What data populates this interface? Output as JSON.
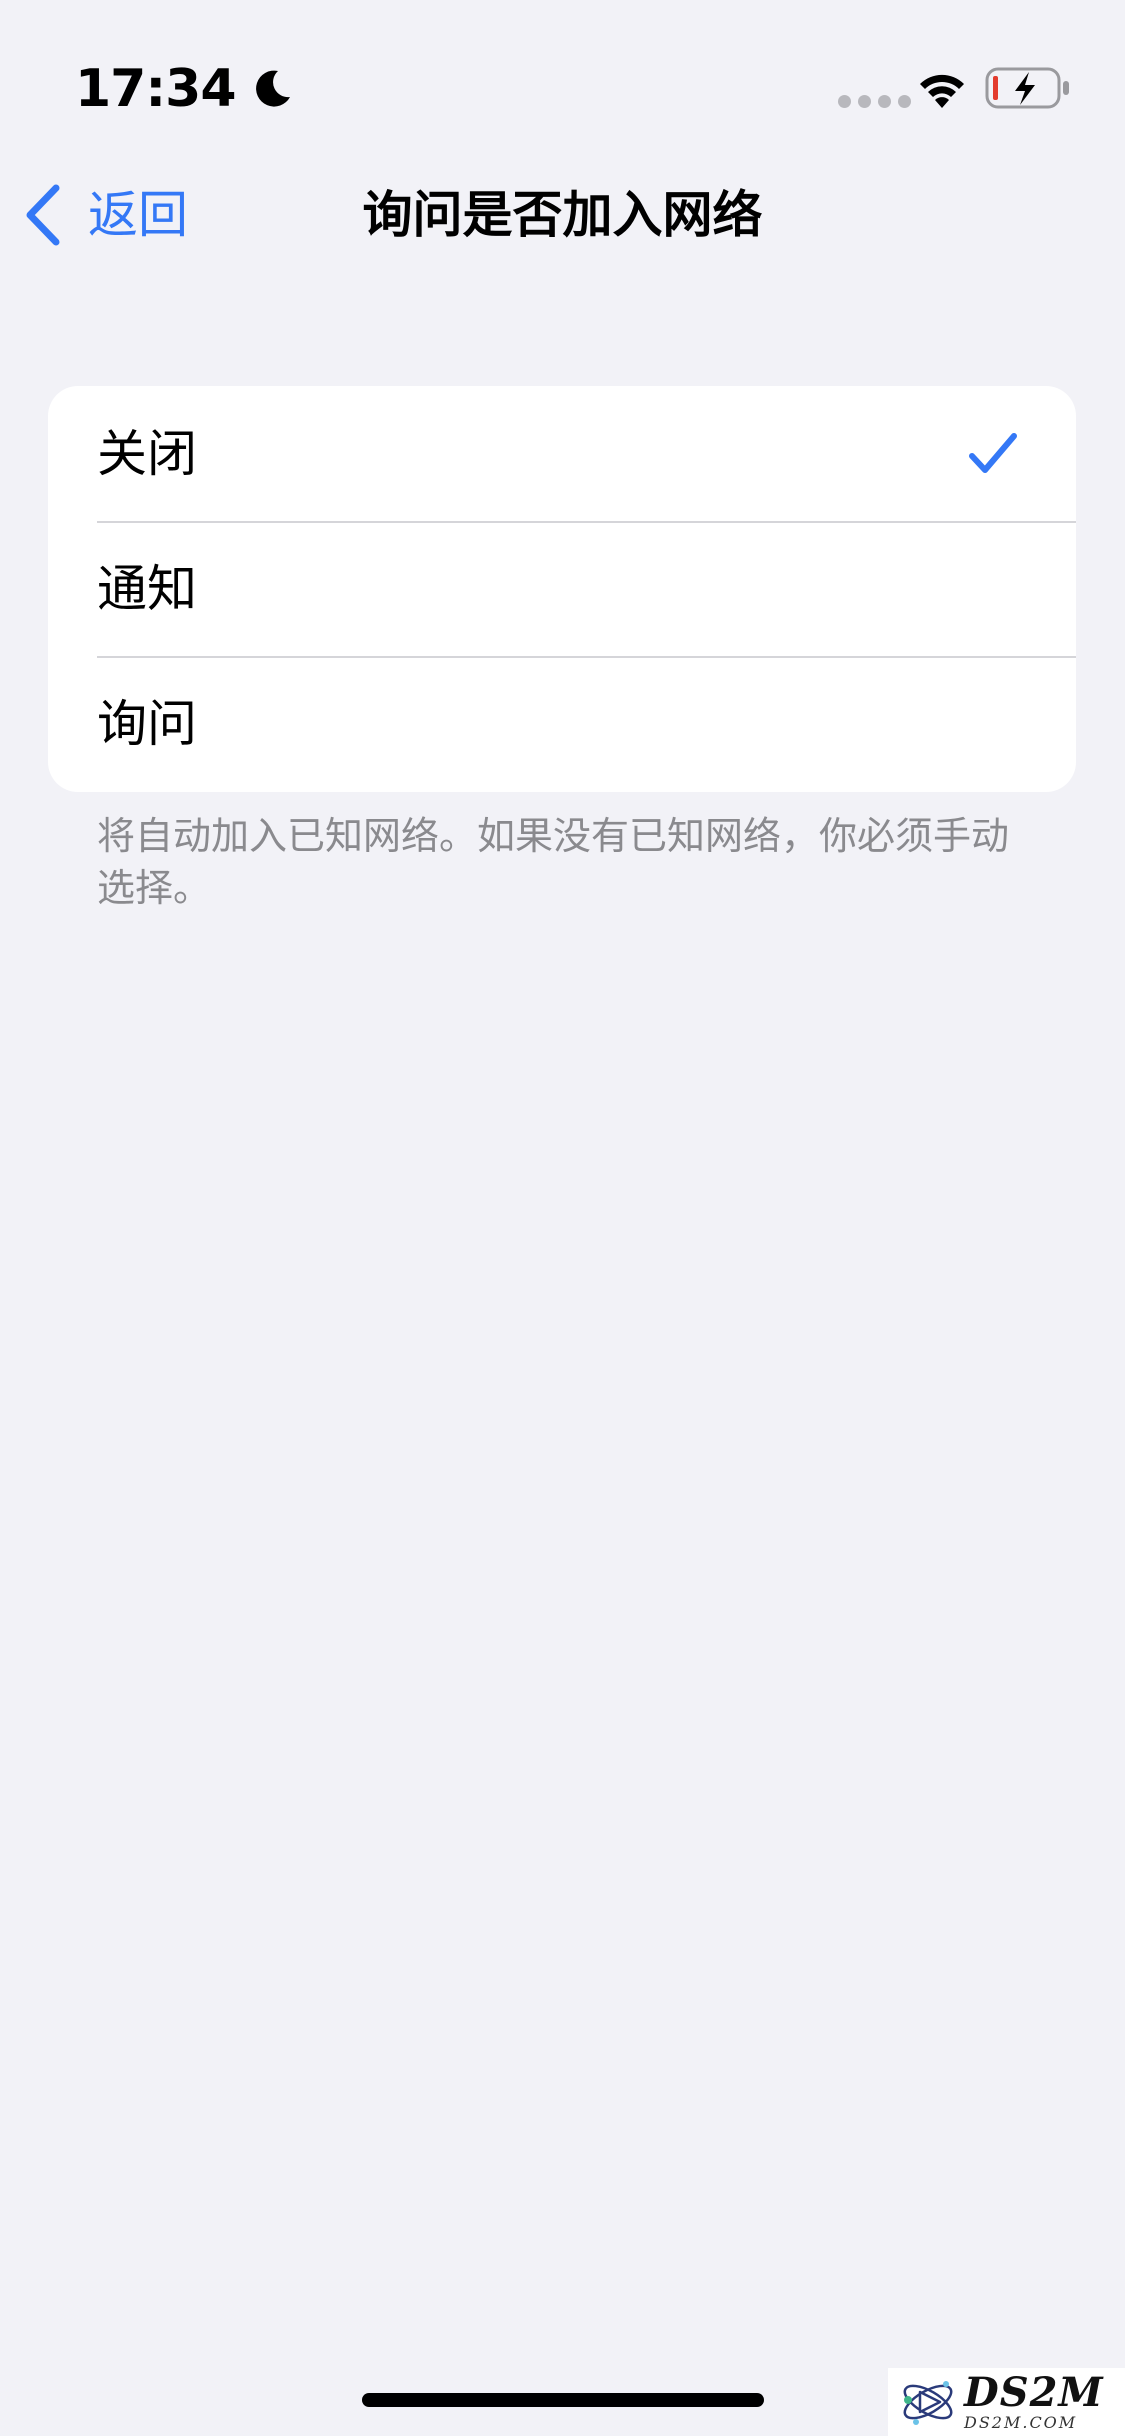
{
  "status_bar": {
    "time": "17:34",
    "icons": [
      "moon-icon",
      "cellular-signal-icon",
      "wifi-icon",
      "battery-charging-icon"
    ],
    "battery_low_color": "#E33B2E"
  },
  "nav": {
    "back_label": "返回",
    "title": "询问是否加入网络"
  },
  "options": [
    {
      "label": "关闭",
      "selected": true
    },
    {
      "label": "通知",
      "selected": false
    },
    {
      "label": "询问",
      "selected": false
    }
  ],
  "footer_text": "将自动加入已知网络。如果没有已知网络，你必须手动选择。",
  "watermark": {
    "main": "DS2M",
    "sub": "DS2M.COM"
  },
  "colors": {
    "accent": "#3478F6",
    "background": "#F2F2F7",
    "card": "#FFFFFF",
    "footer_text": "#8A8A8E"
  }
}
